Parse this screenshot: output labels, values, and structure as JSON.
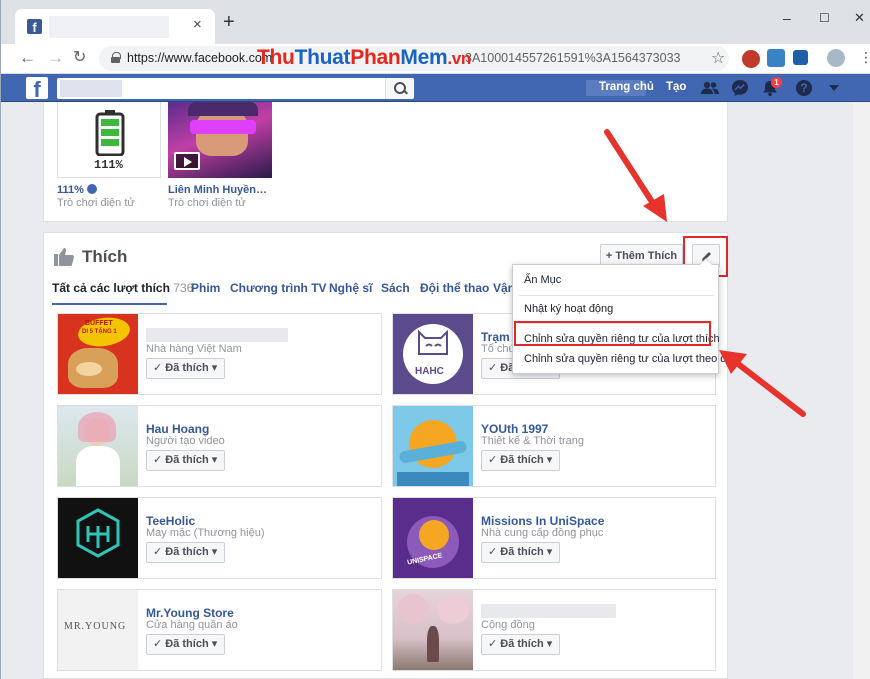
{
  "browser": {
    "tab_close": "×",
    "new_tab": "+",
    "window_controls": {
      "minimize": "–",
      "maximize": "☐",
      "close": "✕"
    },
    "url_visible_start": "https://www.facebook.com",
    "url_visible_end": "3A100014557261591%3A1564373033",
    "watermark": {
      "part1": "Thu",
      "part2": "Thuat",
      "part3": "Phan",
      "part4": "Mem",
      "part5": ".vn"
    }
  },
  "fb_header": {
    "logo": "f",
    "nav_home": "Trang chủ",
    "nav_create": "Tạo",
    "notification_count": "1",
    "help": "?",
    "icons": [
      "friends-icon",
      "messenger-icon",
      "notifications-icon",
      "help-icon",
      "menu-caret-icon"
    ]
  },
  "games": [
    {
      "name": "111%",
      "category": "Trò chơi điện tử",
      "thumb_text": "111%"
    },
    {
      "name": "Liên Minh Huyền…",
      "category": "Trò chơi điện tử"
    }
  ],
  "likes": {
    "title": "Thích",
    "add_button": "+ Thêm Thích",
    "tabs": [
      {
        "label": "Tất cả các lượt thích",
        "count": "736"
      },
      {
        "label": "Phim"
      },
      {
        "label": "Chương trình TV"
      },
      {
        "label": "Nghệ sĩ"
      },
      {
        "label": "Sách"
      },
      {
        "label": "Đội thể thao"
      },
      {
        "label": "Vận"
      }
    ],
    "liked_label": "Đã thích",
    "items": [
      {
        "name": "",
        "category": "Nhà hàng Việt Nam",
        "pic_text1": "BUFFET",
        "pic_text2": "DI 5 TẶNG 1"
      },
      {
        "name": "Trạm C",
        "category": "Tổ chức",
        "pic_text": "HAHC"
      },
      {
        "name": "Hau Hoang",
        "category": "Người tạo video"
      },
      {
        "name": "YOUth 1997",
        "category": "Thiết kế & Thời trang"
      },
      {
        "name": "TeeHolic",
        "category": "May mặc (Thương hiệu)"
      },
      {
        "name": "Missions In UniSpace",
        "category": "Nhà cung cấp đồng phục",
        "pic_text": "UNISPACE"
      },
      {
        "name": "Mr.Young Store",
        "category": "Cửa hàng quần áo",
        "pic_text": "MR.YOUNG"
      },
      {
        "name": "",
        "category": "Cộng đồng"
      }
    ]
  },
  "dropdown": {
    "items": [
      "Ẩn Mục",
      "Nhật ký hoạt động",
      "Chỉnh sửa quyền riêng tư của lượt thích",
      "Chỉnh sửa quyền riêng tư của lượt theo dõi"
    ]
  },
  "colors": {
    "fb_blue": "#4267b2",
    "link": "#365899",
    "highlight_red": "#e0282a"
  }
}
